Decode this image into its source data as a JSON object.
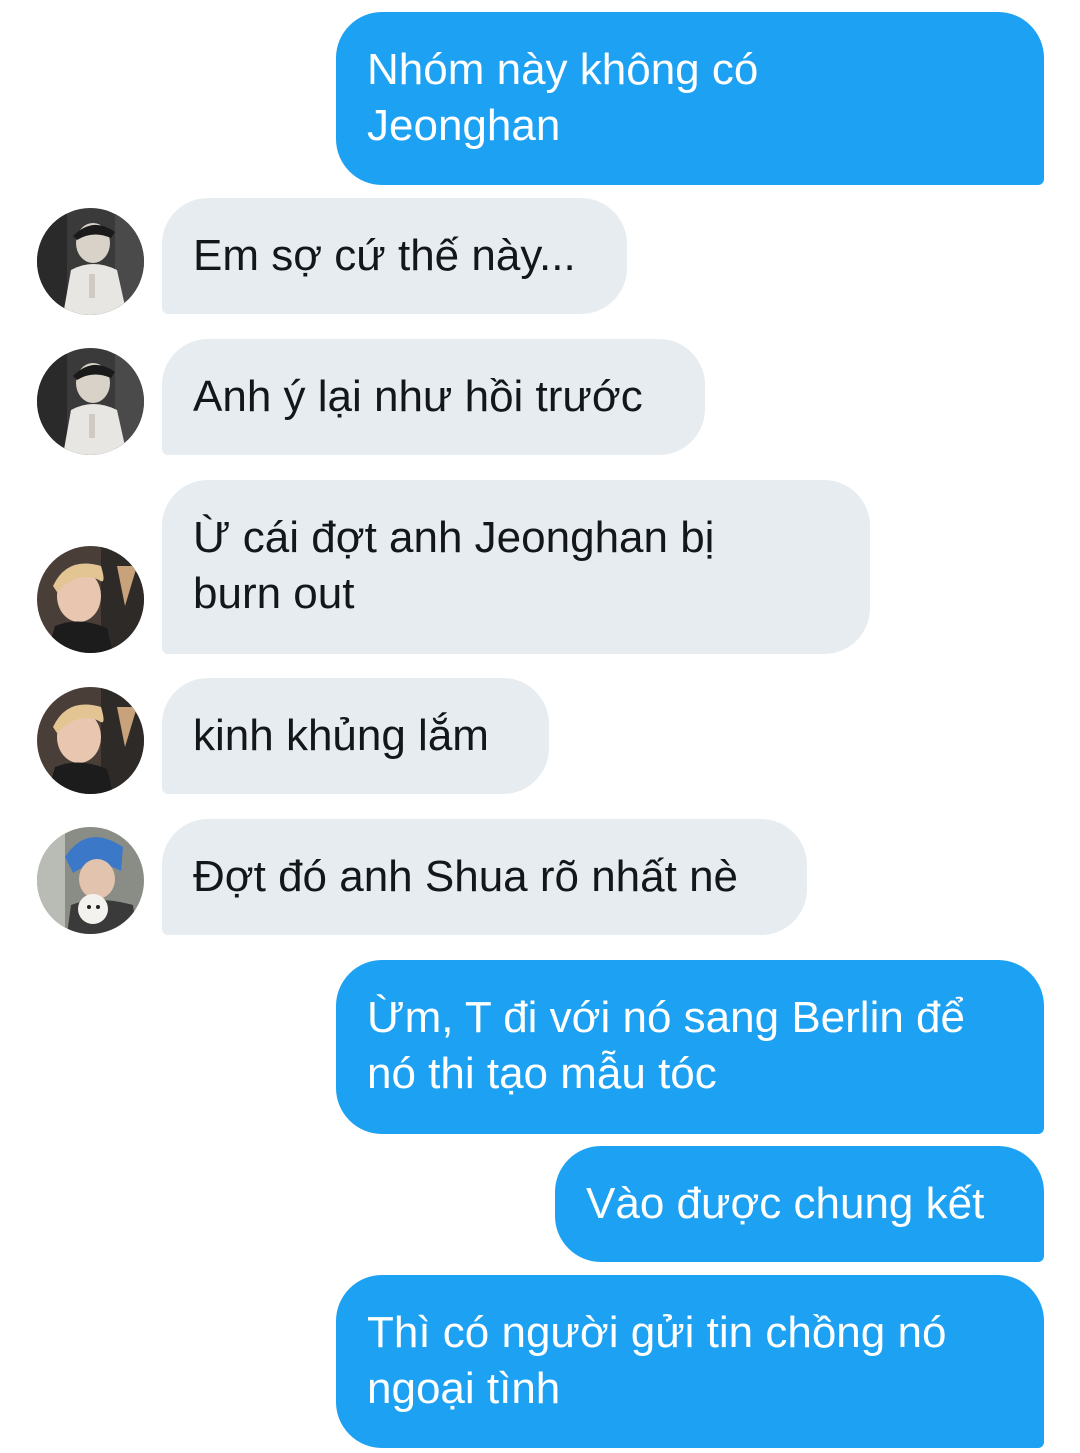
{
  "colors": {
    "outgoing_bubble": "#1da1f2",
    "incoming_bubble": "#e6ecf0",
    "incoming_text": "#14171a",
    "outgoing_text": "#ffffff"
  },
  "messages": [
    {
      "direction": "outgoing",
      "text": "Nhóm này không có\nJeonghan"
    },
    {
      "direction": "incoming",
      "avatar": "avatar-black-hat",
      "text": "Em sợ cứ thế này..."
    },
    {
      "direction": "incoming",
      "avatar": "avatar-black-hat",
      "text": "Anh ý lại như hồi trước"
    },
    {
      "direction": "incoming",
      "avatar": "avatar-blonde",
      "text": "Ừ cái đợt anh Jeonghan bị\nburn out"
    },
    {
      "direction": "incoming",
      "avatar": "avatar-blonde",
      "text": "kinh khủng lắm"
    },
    {
      "direction": "incoming",
      "avatar": "avatar-blue-hair-dog",
      "text": "Đợt đó anh Shua rõ nhất nè"
    },
    {
      "direction": "outgoing",
      "text": "Ừm, T đi với nó sang Berlin để\nnó thi tạo mẫu tóc"
    },
    {
      "direction": "outgoing",
      "text": "Vào được chung kết"
    },
    {
      "direction": "outgoing",
      "text": "Thì có người gửi tin chồng nó\nngoại tình"
    }
  ]
}
